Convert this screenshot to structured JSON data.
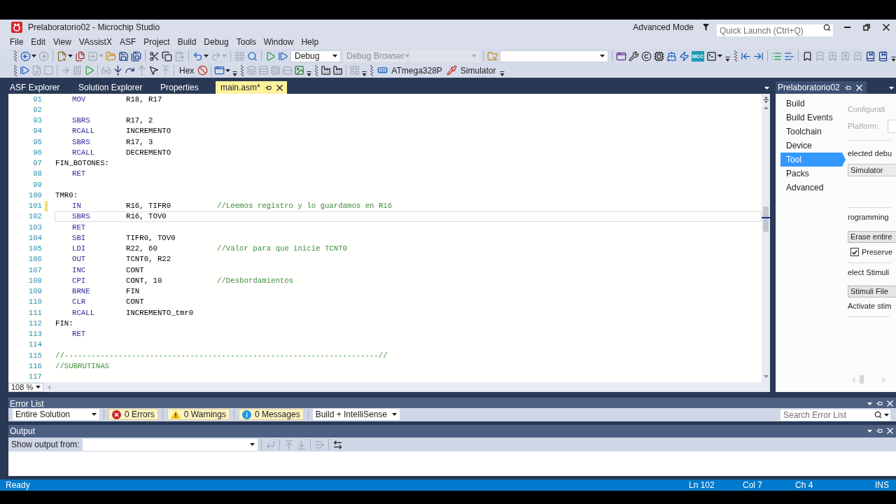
{
  "window": {
    "title": "Prelaboratorio02 - Microchip Studio",
    "mode_label": "Advanced Mode",
    "quick_launch": {
      "placeholder": "Quick Launch (Ctrl+Q)"
    }
  },
  "menu": [
    "File",
    "Edit",
    "View",
    "VAssistX",
    "ASF",
    "Project",
    "Build",
    "Debug",
    "Tools",
    "Window",
    "Help"
  ],
  "toolbars": [
    {
      "items": [
        {
          "kind": "grip"
        },
        {
          "kind": "split",
          "disabled": false
        },
        {
          "kind": "icon",
          "disabled": true
        },
        {
          "kind": "separator"
        },
        {
          "kind": "split",
          "disabled": false
        },
        {
          "kind": "icon",
          "disabled": false
        },
        {
          "kind": "split",
          "disabled": true
        },
        {
          "kind": "icon",
          "disabled": false
        },
        {
          "kind": "icon",
          "disabled": false
        },
        {
          "kind": "icon",
          "disabled": false
        },
        {
          "kind": "separator"
        },
        {
          "kind": "icon",
          "disabled": false
        },
        {
          "kind": "icon",
          "disabled": false
        },
        {
          "kind": "icon",
          "disabled": true
        },
        {
          "kind": "separator"
        },
        {
          "kind": "split",
          "disabled": false
        },
        {
          "kind": "split",
          "disabled": true
        },
        {
          "kind": "separator"
        },
        {
          "kind": "icon",
          "disabled": true
        },
        {
          "kind": "icon",
          "disabled": false
        },
        {
          "kind": "separator"
        },
        {
          "kind": "icon",
          "disabled": false
        },
        {
          "kind": "icon",
          "disabled": false
        },
        {
          "kind": "dropdown",
          "value": "Debug",
          "disabled": false
        },
        {
          "kind": "dropdown",
          "value": "Debug Browser",
          "disabled": true
        },
        {
          "kind": "dropdown",
          "disabled": true
        },
        {
          "kind": "separator"
        },
        {
          "kind": "icon",
          "disabled": false
        },
        {
          "kind": "dropdown",
          "disabled": false
        },
        {
          "kind": "separator"
        },
        {
          "kind": "icon",
          "disabled": false
        },
        {
          "kind": "icon",
          "disabled": false
        },
        {
          "kind": "icon",
          "disabled": false
        },
        {
          "kind": "icon",
          "disabled": false
        },
        {
          "kind": "icon",
          "disabled": false
        },
        {
          "kind": "icon",
          "disabled": false
        },
        {
          "kind": "text_icon",
          "label": "MCC",
          "disabled": false
        },
        {
          "kind": "split",
          "disabled": false
        },
        {
          "kind": "overflow"
        },
        {
          "kind": "grip"
        },
        {
          "kind": "icon",
          "disabled": false
        },
        {
          "kind": "icon",
          "disabled": false
        },
        {
          "kind": "separator"
        },
        {
          "kind": "icon",
          "disabled": false
        },
        {
          "kind": "icon",
          "disabled": false
        },
        {
          "kind": "separator"
        },
        {
          "kind": "icon",
          "disabled": false
        },
        {
          "kind": "icon",
          "disabled": true
        },
        {
          "kind": "icon",
          "disabled": true
        },
        {
          "kind": "icon",
          "disabled": true
        },
        {
          "kind": "icon",
          "disabled": true
        },
        {
          "kind": "icon",
          "disabled": false
        },
        {
          "kind": "icon",
          "disabled": false
        },
        {
          "kind": "overflow"
        }
      ]
    },
    {
      "items": [
        {
          "kind": "grip"
        },
        {
          "kind": "icon",
          "disabled": false
        },
        {
          "kind": "icon",
          "disabled": true
        },
        {
          "kind": "icon",
          "disabled": true
        },
        {
          "kind": "separator"
        },
        {
          "kind": "icon",
          "disabled": true
        },
        {
          "kind": "icon",
          "disabled": true
        },
        {
          "kind": "icon",
          "disabled": false
        },
        {
          "kind": "separator"
        },
        {
          "kind": "icon",
          "disabled": true
        },
        {
          "kind": "icon",
          "disabled": false
        },
        {
          "kind": "icon",
          "disabled": false
        },
        {
          "kind": "icon",
          "disabled": true
        },
        {
          "kind": "icon",
          "disabled": false
        },
        {
          "kind": "icon",
          "disabled": true
        },
        {
          "kind": "separator"
        },
        {
          "kind": "text_button",
          "label": "Hex",
          "disabled": false
        },
        {
          "kind": "icon",
          "disabled": false
        },
        {
          "kind": "separator"
        },
        {
          "kind": "split",
          "disabled": false
        },
        {
          "kind": "overflow"
        },
        {
          "kind": "grip"
        },
        {
          "kind": "icon",
          "disabled": true
        },
        {
          "kind": "icon",
          "disabled": true
        },
        {
          "kind": "icon",
          "disabled": true
        },
        {
          "kind": "icon",
          "disabled": true
        },
        {
          "kind": "icon",
          "disabled": false
        },
        {
          "kind": "overflow"
        },
        {
          "kind": "grip"
        },
        {
          "kind": "icon",
          "disabled": false
        },
        {
          "kind": "icon",
          "disabled": false
        },
        {
          "kind": "separator"
        },
        {
          "kind": "icon",
          "disabled": true
        },
        {
          "kind": "overflow"
        },
        {
          "kind": "grip"
        },
        {
          "kind": "labeled",
          "label": "ATmega328P",
          "disabled": false
        },
        {
          "kind": "labeled",
          "label": "Simulator",
          "disabled": false
        },
        {
          "kind": "overflow"
        }
      ]
    }
  ],
  "doc_tabs": [
    {
      "label": "ASF Explorer",
      "selected": false
    },
    {
      "label": "Solution Explorer",
      "selected": false
    },
    {
      "label": "Properties",
      "selected": false
    },
    {
      "label": "main.asm*",
      "selected": true
    }
  ],
  "editor": {
    "lines": [
      {
        "number": "91",
        "kind": "instruction",
        "mnemonic": "MOV",
        "operands": "R18, R17",
        "modified": false,
        "current": false
      },
      {
        "number": "92",
        "kind": "blank",
        "modified": false,
        "current": false
      },
      {
        "number": "93",
        "kind": "instruction",
        "mnemonic": "SBRS",
        "operands": "R17, 2",
        "modified": false,
        "current": false
      },
      {
        "number": "94",
        "kind": "instruction",
        "mnemonic": "RCALL",
        "operands": "INCREMENTO",
        "modified": false,
        "current": false
      },
      {
        "number": "95",
        "kind": "instruction",
        "mnemonic": "SBRS",
        "operands": "R17, 3",
        "modified": false,
        "current": false
      },
      {
        "number": "96",
        "kind": "instruction",
        "mnemonic": "RCALL",
        "operands": "DECREMENTO",
        "modified": false,
        "current": false
      },
      {
        "number": "97",
        "kind": "label",
        "text": "FIN_BOTONES:",
        "modified": false,
        "current": false
      },
      {
        "number": "98",
        "kind": "instruction",
        "mnemonic": "RET",
        "modified": false,
        "current": false
      },
      {
        "number": "99",
        "kind": "blank",
        "modified": false,
        "current": false
      },
      {
        "number": "100",
        "kind": "label",
        "text": "TMR0:",
        "modified": false,
        "current": false
      },
      {
        "number": "101",
        "kind": "instruction",
        "mnemonic": "IN",
        "operands": "R16, TIFR0",
        "comment": "//Leemos registro y lo guardamos en R16",
        "modified": true,
        "current": false
      },
      {
        "number": "102",
        "kind": "instruction",
        "mnemonic": "SBRS",
        "operands": "R16, TOV0",
        "modified": false,
        "current": true
      },
      {
        "number": "103",
        "kind": "instruction",
        "mnemonic": "RET",
        "modified": false,
        "current": false
      },
      {
        "number": "104",
        "kind": "instruction",
        "mnemonic": "SBI",
        "operands": "TIFR0, TOV0",
        "modified": false,
        "current": false
      },
      {
        "number": "105",
        "kind": "instruction",
        "mnemonic": "LDI",
        "operands": "R22, 60",
        "comment": "//Valor para que inicie TCNT0",
        "modified": false,
        "current": false
      },
      {
        "number": "106",
        "kind": "instruction",
        "mnemonic": "OUT",
        "operands": "TCNT0, R22",
        "modified": false,
        "current": false
      },
      {
        "number": "107",
        "kind": "instruction",
        "mnemonic": "INC",
        "operands": "CONT",
        "modified": false,
        "current": false
      },
      {
        "number": "108",
        "kind": "instruction",
        "mnemonic": "CPI",
        "operands": "CONT, 10",
        "comment": "//Desbordamientos",
        "modified": false,
        "current": false
      },
      {
        "number": "109",
        "kind": "instruction",
        "mnemonic": "BRNE",
        "operands": "FIN",
        "modified": false,
        "current": false
      },
      {
        "number": "110",
        "kind": "instruction",
        "mnemonic": "CLR",
        "operands": "CONT",
        "modified": false,
        "current": false
      },
      {
        "number": "111",
        "kind": "instruction",
        "mnemonic": "RCALL",
        "operands": "INCREMENTO_tmr0",
        "modified": false,
        "current": false
      },
      {
        "number": "112",
        "kind": "label",
        "text": "FIN:",
        "modified": false,
        "current": false
      },
      {
        "number": "113",
        "kind": "instruction",
        "mnemonic": "RET",
        "modified": false,
        "current": false
      },
      {
        "number": "114",
        "kind": "blank",
        "modified": false,
        "current": false
      },
      {
        "number": "115",
        "kind": "comment",
        "text": "//----------------------------------------------------------------------//",
        "modified": false,
        "current": false
      },
      {
        "number": "116",
        "kind": "comment",
        "text": "//SUBRUTINAS",
        "modified": false,
        "current": false
      },
      {
        "number": "117",
        "kind": "blank",
        "modified": false,
        "current": false
      }
    ],
    "zoom": "108 %"
  },
  "properties_panel": {
    "tab": "Prelaboratorio02",
    "nav": [
      {
        "label": "Build",
        "selected": false
      },
      {
        "label": "Build Events",
        "selected": false
      },
      {
        "label": "Toolchain",
        "selected": false
      },
      {
        "label": "Device",
        "selected": false
      },
      {
        "label": "Tool",
        "selected": true
      },
      {
        "label": "Packs",
        "selected": false
      },
      {
        "label": "Advanced",
        "selected": false
      }
    ],
    "content": [
      {
        "kind": "text",
        "text": "Configurati",
        "disabled": true
      },
      {
        "kind": "field",
        "label": "Platform:",
        "disabled": true
      },
      {
        "kind": "divider"
      },
      {
        "kind": "text",
        "text": "elected debu",
        "disabled": false
      },
      {
        "kind": "dropdown",
        "text": "Simulator",
        "disabled": false
      },
      {
        "kind": "divider"
      },
      {
        "kind": "text",
        "text": "rogramming",
        "disabled": false
      },
      {
        "kind": "button",
        "text": "Erase entire",
        "disabled": false
      },
      {
        "kind": "checkbox",
        "text": "Preserve",
        "checked": true
      },
      {
        "kind": "divider"
      },
      {
        "kind": "text",
        "text": "elect Stimuli",
        "disabled": false
      },
      {
        "kind": "button",
        "text": "Stimuli File",
        "disabled": false
      },
      {
        "kind": "text",
        "text": "Activate stim",
        "disabled": false
      },
      {
        "kind": "divider"
      }
    ]
  },
  "error_list": {
    "title": "Error List",
    "scope": "Entire Solution",
    "filters": [
      {
        "kind": "error",
        "label": "0 Errors",
        "selected": true
      },
      {
        "kind": "warning",
        "label": "0 Warnings",
        "selected": true
      },
      {
        "kind": "message",
        "label": "0 Messages",
        "selected": true
      }
    ],
    "source": "Build + IntelliSense",
    "search": {
      "placeholder": "Search Error List"
    }
  },
  "output": {
    "title": "Output",
    "source_label": "Show output from:",
    "tools": [
      {
        "kind": "separator"
      },
      {
        "kind": "icon",
        "disabled": true
      },
      {
        "kind": "separator"
      },
      {
        "kind": "icon",
        "disabled": true
      },
      {
        "kind": "icon",
        "disabled": true
      },
      {
        "kind": "separator"
      },
      {
        "kind": "icon",
        "disabled": true
      },
      {
        "kind": "separator"
      },
      {
        "kind": "icon",
        "disabled": false
      }
    ]
  },
  "status_bar": {
    "text": "Ready",
    "line": "Ln 102",
    "column": "Col 7",
    "char": "Ch 4",
    "mode": "INS"
  }
}
